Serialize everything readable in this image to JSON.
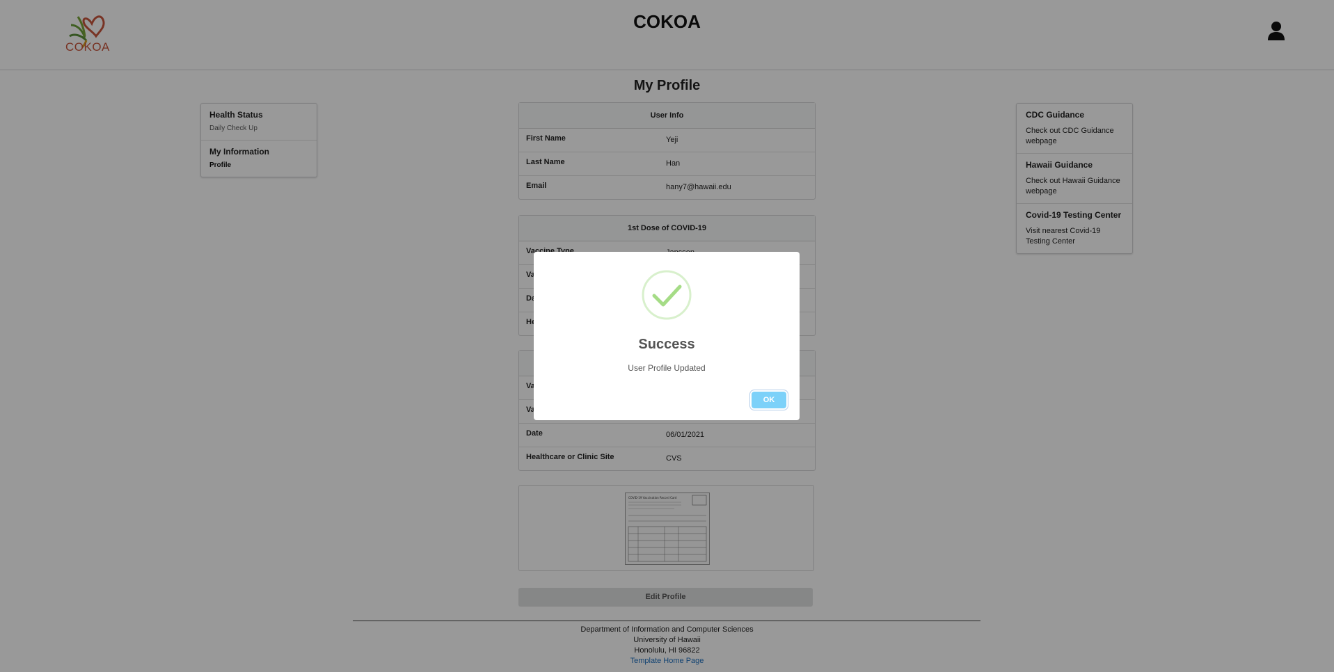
{
  "header": {
    "logo_text": "COKOA",
    "app_title": "COKOA"
  },
  "page_title": "My Profile",
  "left_menu": {
    "groups": [
      {
        "header": "Health Status",
        "items": [
          {
            "label": "Daily Check Up",
            "active": false
          }
        ]
      },
      {
        "header": "My Information",
        "items": [
          {
            "label": "Profile",
            "active": true
          }
        ]
      }
    ]
  },
  "right_menu": {
    "groups": [
      {
        "header": "CDC Guidance",
        "link": "Check out CDC Guidance webpage"
      },
      {
        "header": "Hawaii Guidance",
        "link": "Check out Hawaii Guidance webpage"
      },
      {
        "header": "Covid-19 Testing Center",
        "link": "Visit nearest Covid-19 Testing Center"
      }
    ]
  },
  "user_info": {
    "title": "User Info",
    "rows": [
      {
        "label": "First Name",
        "value": "Yeji"
      },
      {
        "label": "Last Name",
        "value": "Han"
      },
      {
        "label": "Email",
        "value": "hany7@hawaii.edu"
      }
    ]
  },
  "dose1": {
    "title": "1st Dose of COVID-19",
    "rows": [
      {
        "label": "Vaccine Type",
        "value": "Janssen"
      },
      {
        "label": "Va",
        "value": ""
      },
      {
        "label": "Da",
        "value": ""
      },
      {
        "label": "He",
        "value": ""
      }
    ]
  },
  "dose2": {
    "title": "",
    "rows": [
      {
        "label": "Va",
        "value": ""
      },
      {
        "label": "Va",
        "value": ""
      },
      {
        "label": "Date",
        "value": "06/01/2021"
      },
      {
        "label": "Healthcare or Clinic Site",
        "value": "CVS"
      }
    ]
  },
  "vaccination_card": {
    "caption": "COVID-19 Vaccination Record Card"
  },
  "edit_button": "Edit Profile",
  "footer": {
    "line1": "Department of Information and Computer Sciences",
    "line2": "University of Hawaii",
    "line3": "Honolulu, HI 96822",
    "link": "Template Home Page"
  },
  "modal": {
    "title": "Success",
    "text": "User Profile Updated",
    "ok": "OK",
    "icon": "check-circle-icon",
    "icon_color": "#a5dc86",
    "ok_color": "#7cd1f9"
  },
  "colors": {
    "logo": "#c8553d",
    "link": "#1e70bf"
  }
}
